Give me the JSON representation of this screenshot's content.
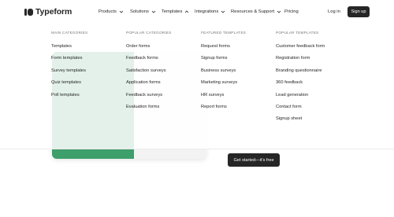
{
  "brand": {
    "name": "Typeform"
  },
  "nav": {
    "products": "Products",
    "solutions": "Solutions",
    "templates": "Templates",
    "integrations": "Integrations",
    "resources": "Resources & Support",
    "pricing": "Pricing",
    "login": "Log in",
    "signup": "Sign up"
  },
  "dropdown": {
    "main_categories": {
      "heading": "MAIN CATEGORIES",
      "items": [
        "Templates",
        "Form templates",
        "Survey templates",
        "Quiz templates",
        "Poll templates"
      ]
    },
    "popular_categories": {
      "heading": "POPULAR CATEGORIES",
      "items": [
        "Order forms",
        "Feedback forms",
        "Satisfaction surveys",
        "Application forms",
        "Feedback surveys",
        "Evaluation forms"
      ]
    },
    "featured_templates": {
      "heading": "FEATURED TEMPLATES",
      "items": [
        "Request forms",
        "Signup forms",
        "Business surveys",
        "Marketing surveys",
        "HR surveys",
        "Report forms"
      ]
    },
    "popular_templates": {
      "heading": "POPULAR TEMPLATES",
      "items": [
        "Customer feedback form",
        "Registration form",
        "Branding questionnaire",
        "360 feedback",
        "Lead generation",
        "Contact form",
        "Signup sheet"
      ]
    }
  },
  "hero": {
    "cta": "Get started—it's free"
  },
  "colors": {
    "brand_dark": "#262627",
    "hero_green": "#3d9f6b"
  }
}
